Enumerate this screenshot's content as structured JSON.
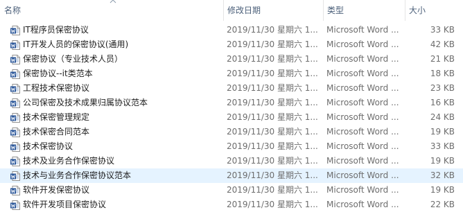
{
  "header": {
    "name_label": "名称",
    "date_label": "修改日期",
    "type_label": "类型",
    "size_label": "大小",
    "sort_indicator": "sort-ascending-icon"
  },
  "colors": {
    "header_text": "#4c607a",
    "row_hover": "#e5f3ff",
    "word_icon_blue": "#2b579a"
  },
  "files": [
    {
      "name": "IT程序员保密协议",
      "date": "2019/11/30 星期六 1...",
      "type": "Microsoft Word ...",
      "size": "33 KB",
      "icon": "word-document-icon"
    },
    {
      "name": "IT开发人员的保密协议(通用)",
      "date": "2019/11/30 星期六 1...",
      "type": "Microsoft Word ...",
      "size": "42 KB",
      "icon": "word-document-icon"
    },
    {
      "name": "保密协议（专业技术人员）",
      "date": "2019/11/30 星期六 1...",
      "type": "Microsoft Word ...",
      "size": "21 KB",
      "icon": "word-document-icon"
    },
    {
      "name": "保密协议--it类范本",
      "date": "2019/11/30 星期六 1...",
      "type": "Microsoft Word ...",
      "size": "18 KB",
      "icon": "word-document-icon"
    },
    {
      "name": "工程技术保密协议",
      "date": "2019/11/30 星期六 1...",
      "type": "Microsoft Word ...",
      "size": "23 KB",
      "icon": "word-document-icon"
    },
    {
      "name": "公司保密及技术成果归属协议范本",
      "date": "2019/11/30 星期六 1...",
      "type": "Microsoft Word ...",
      "size": "16 KB",
      "icon": "word-document-icon"
    },
    {
      "name": "技术保密管理规定",
      "date": "2019/11/30 星期六 1...",
      "type": "Microsoft Word ...",
      "size": "24 KB",
      "icon": "word-document-icon"
    },
    {
      "name": "技术保密合同范本",
      "date": "2019/11/30 星期六 1...",
      "type": "Microsoft Word ...",
      "size": "19 KB",
      "icon": "word-document-icon"
    },
    {
      "name": "技术保密协议",
      "date": "2019/11/30 星期六 1...",
      "type": "Microsoft Word ...",
      "size": "33 KB",
      "icon": "word-document-icon"
    },
    {
      "name": "技术及业务合作保密协议",
      "date": "2019/11/30 星期六 1...",
      "type": "Microsoft Word ...",
      "size": "19 KB",
      "icon": "word-document-icon"
    },
    {
      "name": "技术与业务合作保密协议范本",
      "date": "2019/11/30 星期六 1...",
      "type": "Microsoft Word ...",
      "size": "32 KB",
      "icon": "word-document-icon",
      "hovered": true
    },
    {
      "name": "软件开发保密协议",
      "date": "2019/11/30 星期六 1...",
      "type": "Microsoft Word ...",
      "size": "19 KB",
      "icon": "word-document-icon"
    },
    {
      "name": "软件开发项目保密协议",
      "date": "2019/11/30 星期六 1...",
      "type": "Microsoft Word ...",
      "size": "22 KB",
      "icon": "word-document-icon"
    }
  ]
}
